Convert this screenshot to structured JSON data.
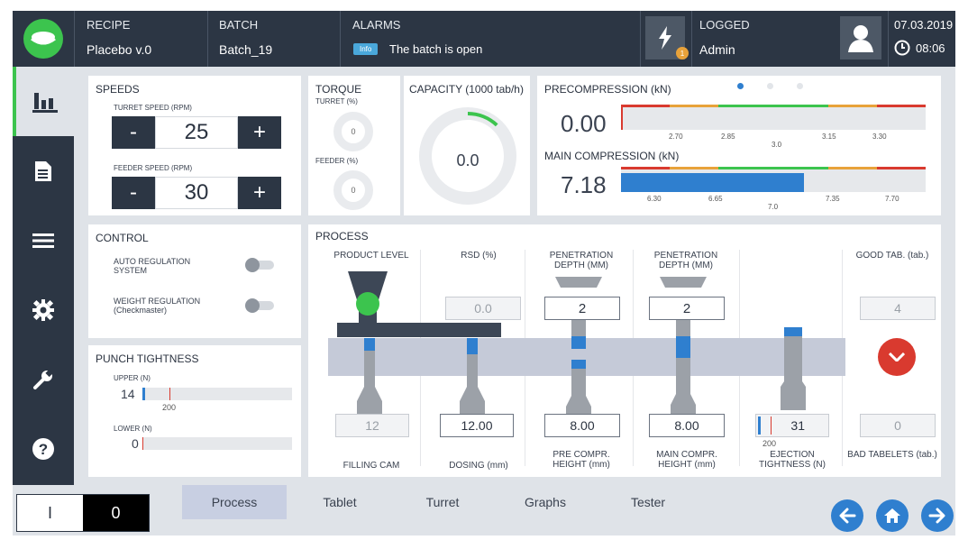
{
  "header": {
    "recipe_label": "RECIPE",
    "recipe_value": "Placebo v.0",
    "batch_label": "BATCH",
    "batch_value": "Batch_19",
    "alarms_label": "ALARMS",
    "alarm_badge": "Info",
    "alarm_text": "The batch is open",
    "alarm_count": "1",
    "logged_label": "LOGGED",
    "logged_value": "Admin",
    "date": "07.03.2019",
    "time": "08:06"
  },
  "speeds": {
    "title": "SPEEDS",
    "turret_label": "TURRET SPEED (rpm)",
    "turret_value": "25",
    "feeder_label": "FEEDER SPEED (rpm)",
    "feeder_value": "30",
    "minus": "-",
    "plus": "+"
  },
  "torque": {
    "title": "TORQUE",
    "turret_label": "TURRET (%)",
    "turret_value": "0",
    "feeder_label": "FEEDER (%)",
    "feeder_value": "0"
  },
  "capacity": {
    "title": "CAPACITY (1000 tab/h)",
    "value": "0.0",
    "arc_fraction": 0.12
  },
  "precompression": {
    "title": "PRECOMPRESSION (kN)",
    "value": "0.00",
    "ticks": [
      "2.70",
      "2.85",
      "3.0",
      "3.15",
      "3.30"
    ],
    "main_title": "MAIN COMPRESSION (kN)",
    "main_value": "7.18",
    "main_ticks": [
      "6.30",
      "6.65",
      "7.0",
      "7.35",
      "7.70"
    ],
    "main_fill_fraction": 0.6
  },
  "control": {
    "title": "CONTROL",
    "auto_label": "AUTO REGULATION SYSTEM",
    "weight_label": "WEIGHT REGULATION (Checkmaster)"
  },
  "punch": {
    "title": "PUNCH TIGHTNESS",
    "upper_label": "UPPER (N)",
    "upper_value": "14",
    "upper_limit": "200",
    "lower_label": "LOWER (N)",
    "lower_value": "0"
  },
  "process": {
    "title": "PROCESS",
    "product_level": "PRODUCT LEVEL",
    "rsd": "RSD (%)",
    "rsd_value": "0.0",
    "pen1": "PENETRATION DEPTH (mm)",
    "pen1_value": "2",
    "pen2": "PENETRATION DEPTH (mm)",
    "pen2_value": "2",
    "good_tab": "GOOD TAB. (tab.)",
    "good_tab_value": "4",
    "filling_value": "12",
    "filling_label": "FILLING CAM",
    "dosing_value": "12.00",
    "dosing_label": "DOSING (mm)",
    "pre_value": "8.00",
    "pre_label": "PRE COMPR. HEIGHT (mm)",
    "main_value": "8.00",
    "main_label": "MAIN COMPR. HEIGHT (mm)",
    "eject_value": "31",
    "eject_limit": "200",
    "eject_label": "EJECTION TIGHTNESS (N)",
    "bad_value": "0",
    "bad_label": "BAD TABELETS (tab.)"
  },
  "footer": {
    "mode_left": "I",
    "mode_right": "0",
    "tabs": [
      "Process",
      "Tablet",
      "Turret",
      "Graphs",
      "Tester"
    ]
  },
  "colors": {
    "dark": "#2c3644",
    "accent_blue": "#2f7fcf",
    "green": "#3cc44e",
    "red": "#d93a2f",
    "orange": "#e8a23a"
  }
}
